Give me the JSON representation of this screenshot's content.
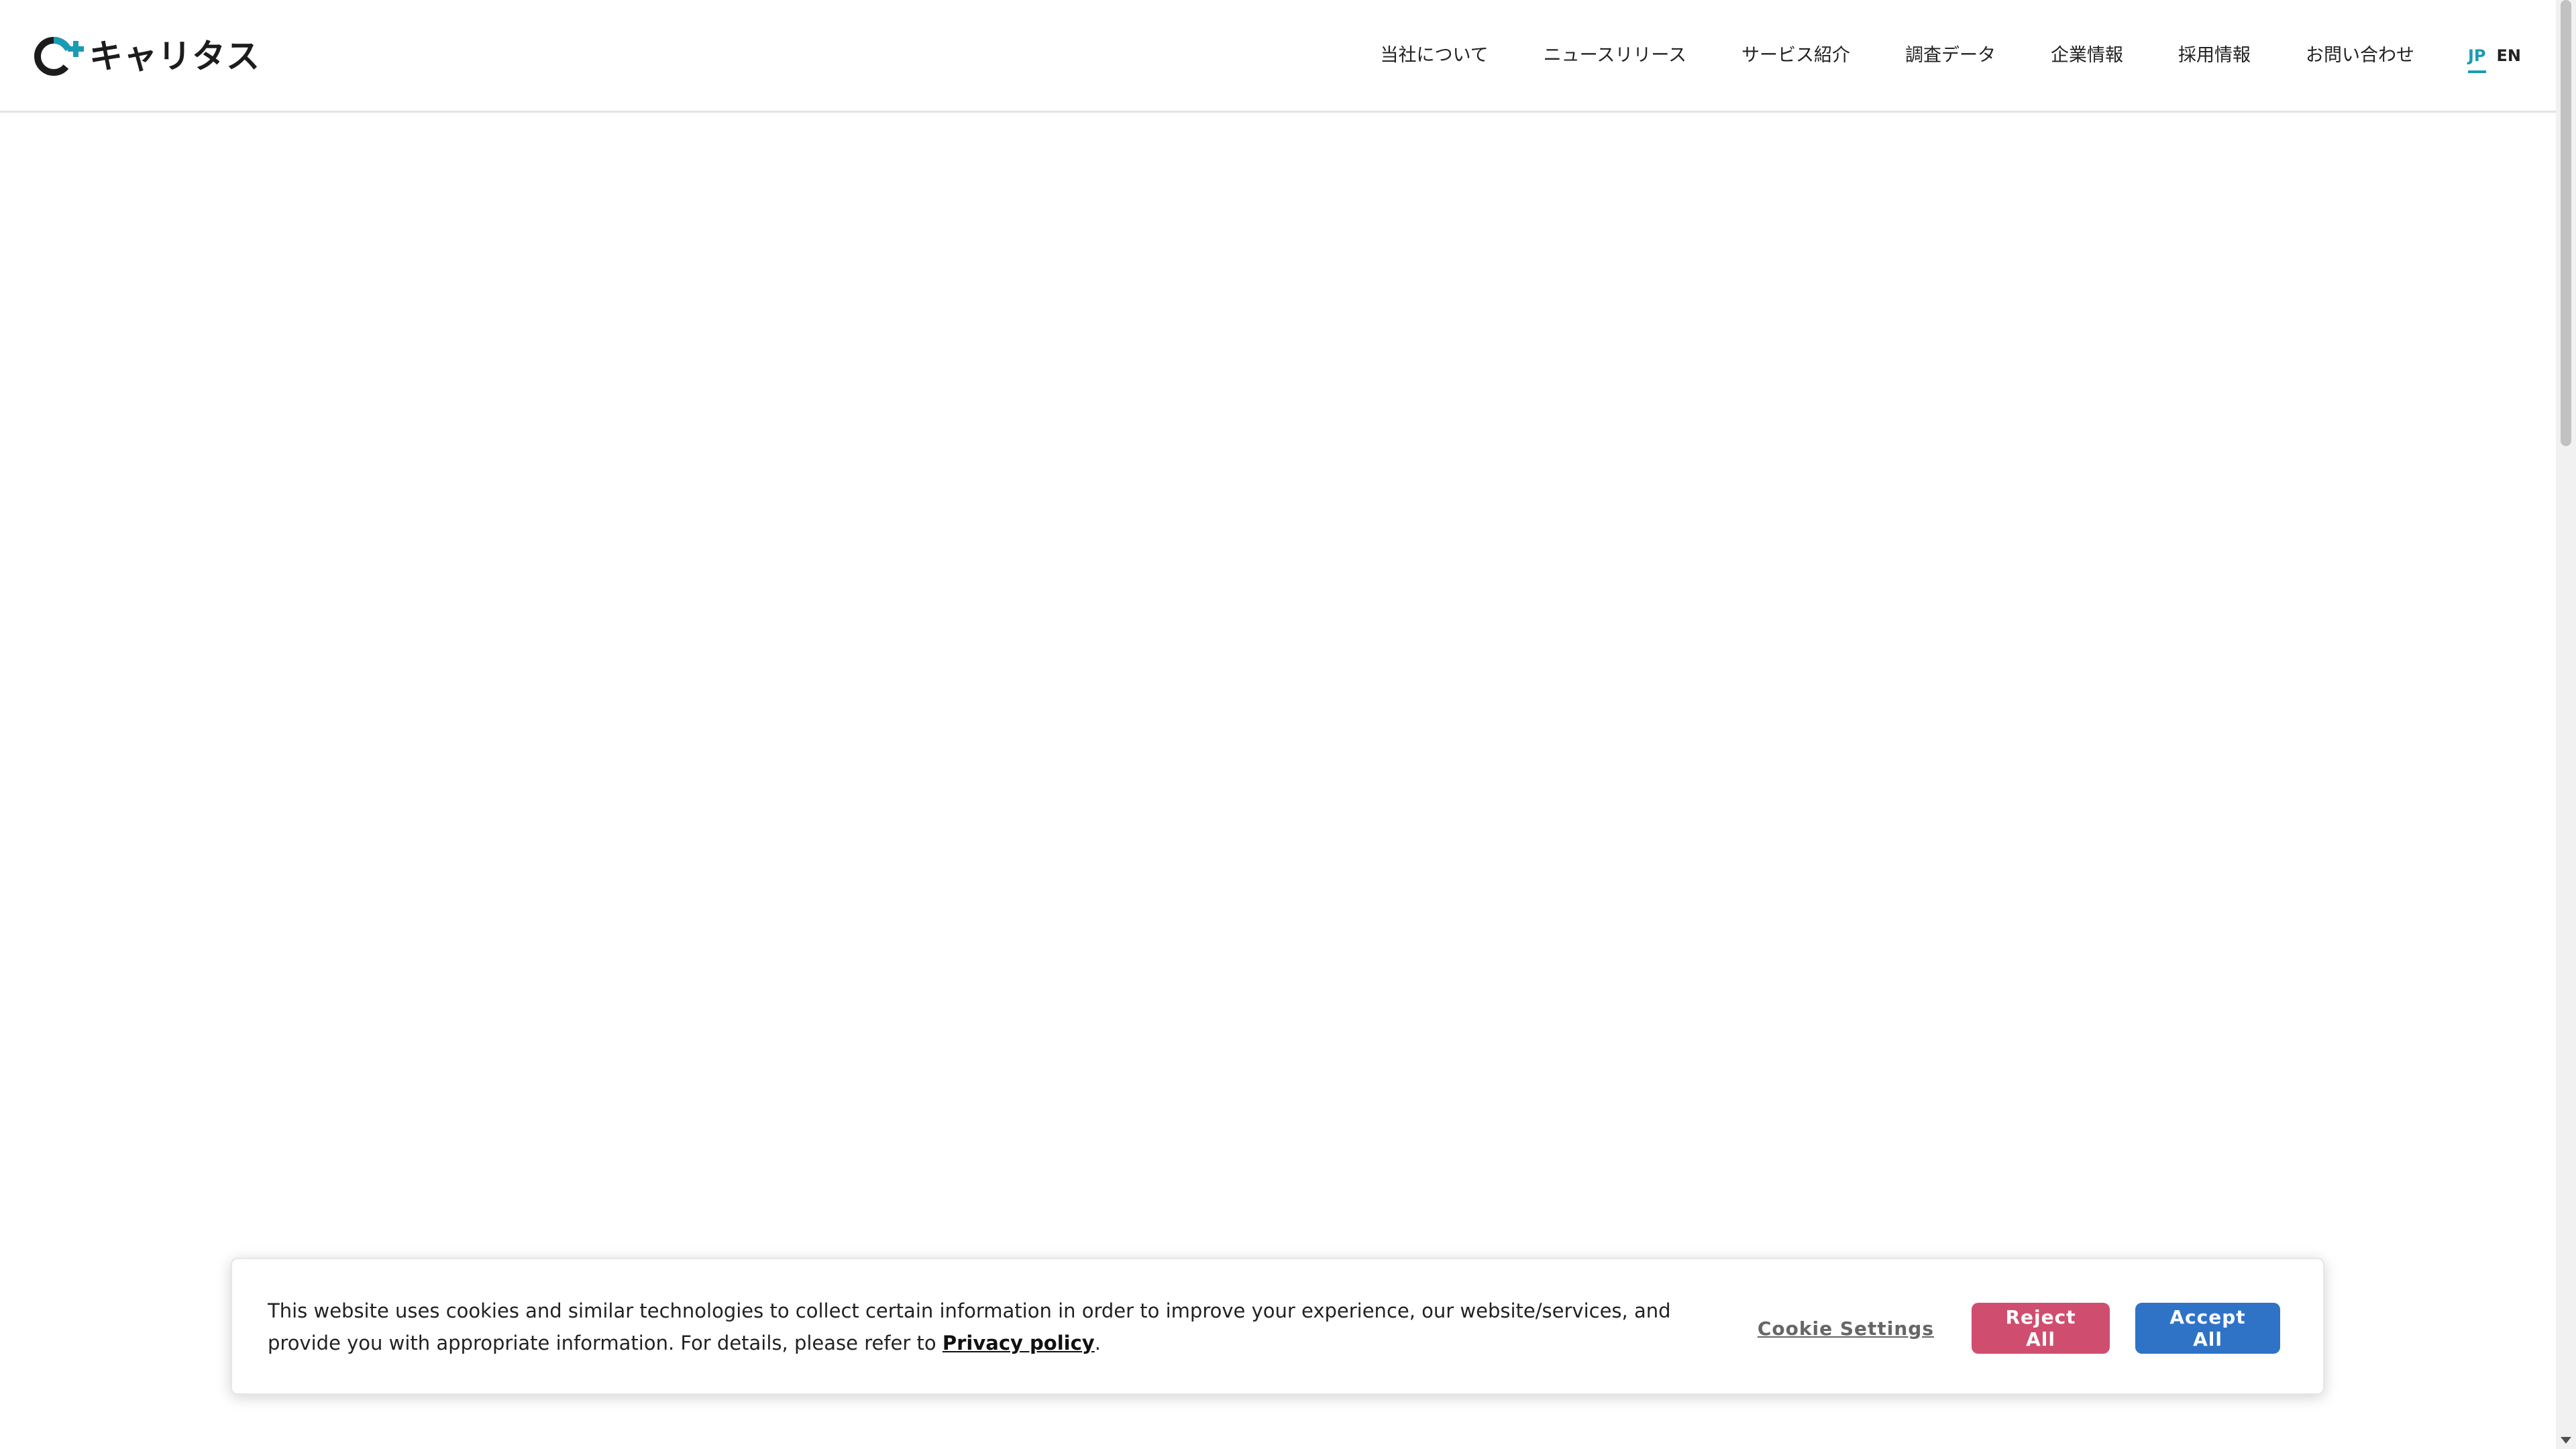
{
  "header": {
    "logo_text": "キャリタス",
    "nav": [
      {
        "label": "当社について"
      },
      {
        "label": "ニュースリリース"
      },
      {
        "label": "サービス紹介"
      },
      {
        "label": "調査データ"
      },
      {
        "label": "企業情報"
      },
      {
        "label": "採用情報"
      },
      {
        "label": "お問い合わせ"
      }
    ],
    "lang": {
      "active": "JP",
      "other": "EN"
    }
  },
  "cookie_banner": {
    "text": "This website uses cookies and similar technologies to collect certain information in order to improve your experience, our website/services, and provide you with appropriate information. For details, please refer to ",
    "privacy_link": "Privacy policy",
    "text_end": ".",
    "settings_label": "Cookie Settings",
    "reject_label": "Reject All",
    "accept_label": "Accept All"
  },
  "colors": {
    "accent": "#1a9bb5",
    "reject": "#cf4e6f",
    "accept": "#2f73c7"
  }
}
